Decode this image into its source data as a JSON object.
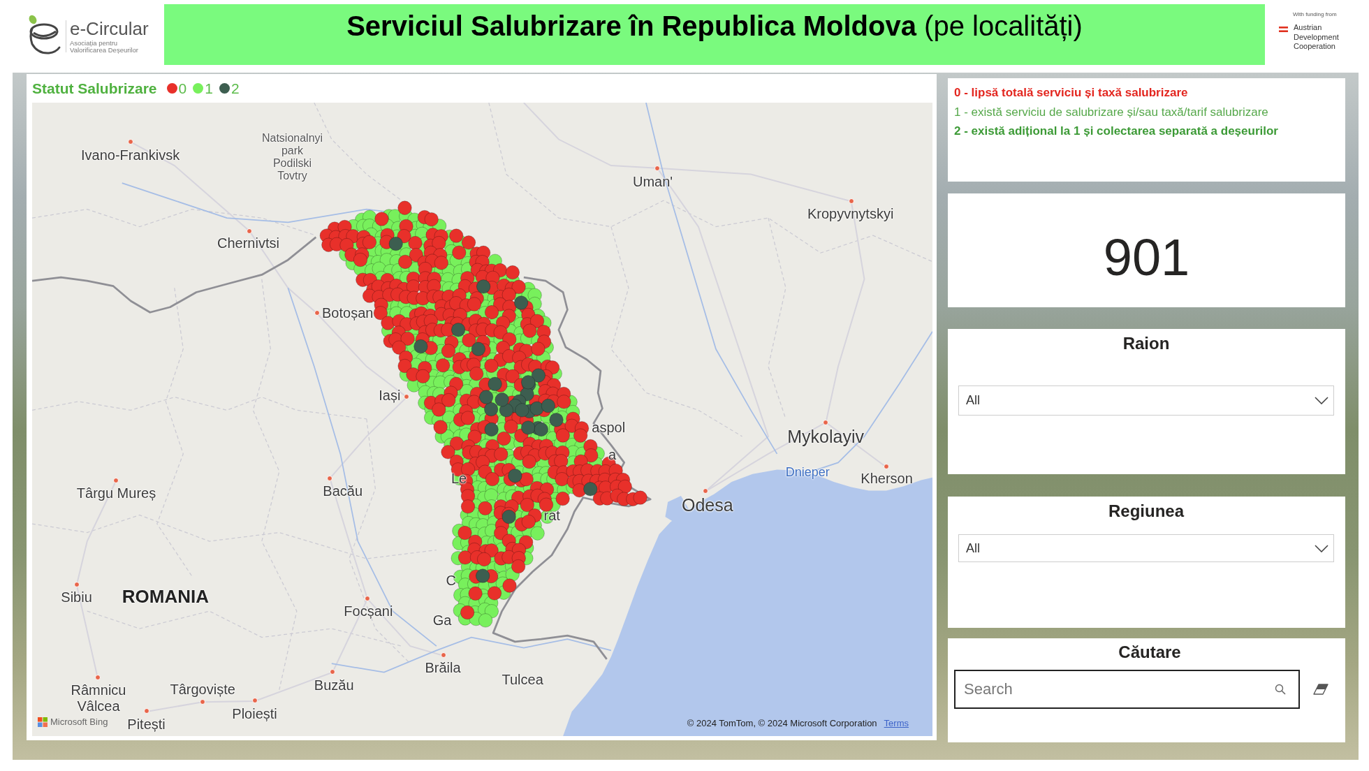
{
  "header": {
    "logo": {
      "name": "e-Circular",
      "subtitle": [
        "Asociația pentru",
        "Valorificarea Deșeurilor"
      ]
    },
    "title": "**Serviciul Salubrizare în Republica Moldova** (pe localități)",
    "funding": {
      "caption": "With funding from",
      "name": "Austrian Development Cooperation"
    }
  },
  "legend": {
    "title": "Statut Salubrizare",
    "items": [
      {
        "label": "0",
        "color": "#e8302a"
      },
      {
        "label": "1",
        "color": "#78f05c"
      },
      {
        "label": "2",
        "color": "#3d5e50"
      }
    ]
  },
  "map": {
    "labels": [
      {
        "text": "Ivano-Frankivsk",
        "kind": "city",
        "marker": true
      },
      {
        "text": "Natsionalnyi park Podilski Tovtry",
        "kind": "park",
        "marker": false
      },
      {
        "text": "Uman'",
        "kind": "city",
        "marker": true
      },
      {
        "text": "Kropyvnytskyi",
        "kind": "city",
        "marker": true
      },
      {
        "text": "Chernivtsi",
        "kind": "city",
        "marker": true
      },
      {
        "text": "Botoșan",
        "kind": "city",
        "marker": true
      },
      {
        "text": "Iași",
        "kind": "city",
        "marker": true
      },
      {
        "text": "aspol",
        "kind": "city",
        "marker": false
      },
      {
        "text": "Mykolayiv",
        "kind": "major",
        "marker": true
      },
      {
        "text": "a",
        "kind": "city",
        "marker": false
      },
      {
        "text": "Dnieper",
        "kind": "river",
        "marker": false
      },
      {
        "text": "Le",
        "kind": "city",
        "marker": false
      },
      {
        "text": "Kherson",
        "kind": "city",
        "marker": true
      },
      {
        "text": "Târgu Mureș",
        "kind": "city",
        "marker": true
      },
      {
        "text": "Bacău",
        "kind": "city",
        "marker": true
      },
      {
        "text": "Odesa",
        "kind": "major",
        "marker": true
      },
      {
        "text": "rat",
        "kind": "city",
        "marker": false
      },
      {
        "text": "C",
        "kind": "city",
        "marker": false
      },
      {
        "text": "Sibiu",
        "kind": "city",
        "marker": true
      },
      {
        "text": "ROMANIA",
        "kind": "country",
        "marker": false
      },
      {
        "text": "Focșani",
        "kind": "city",
        "marker": true
      },
      {
        "text": "Ga",
        "kind": "city",
        "marker": false
      },
      {
        "text": "Brăila",
        "kind": "city",
        "marker": true
      },
      {
        "text": "Tulcea",
        "kind": "city",
        "marker": false
      },
      {
        "text": "Buzău",
        "kind": "city",
        "marker": true
      },
      {
        "text": "Râmnicu Vâlcea",
        "kind": "city",
        "marker": true
      },
      {
        "text": "Târgoviște",
        "kind": "city",
        "marker": true
      },
      {
        "text": "Ploiești",
        "kind": "city",
        "marker": true
      },
      {
        "text": "Pitești",
        "kind": "city",
        "marker": true
      }
    ],
    "provider": "Microsoft Bing",
    "attribution": "© 2024 TomTom, © 2024 Microsoft Corporation",
    "terms_link": "Terms"
  },
  "status_descriptions": [
    {
      "text": "0 - lipsă totală serviciu și taxă salubrizare",
      "color": "#e3261f",
      "bold": true
    },
    {
      "text": "1 - există serviciu de salubrizare și/sau taxă/tarif salubrizare",
      "color": "#56a84b",
      "bold": false
    },
    {
      "text": "2 - există adițional la 1 și colectarea separată a deșeurilor",
      "color": "#3c9a36",
      "bold": true
    }
  ],
  "count": {
    "value": "901"
  },
  "filters": [
    {
      "title": "Raion",
      "value": "All"
    },
    {
      "title": "Regiunea",
      "value": "All"
    }
  ],
  "search": {
    "title": "Căutare",
    "placeholder": "Search"
  }
}
